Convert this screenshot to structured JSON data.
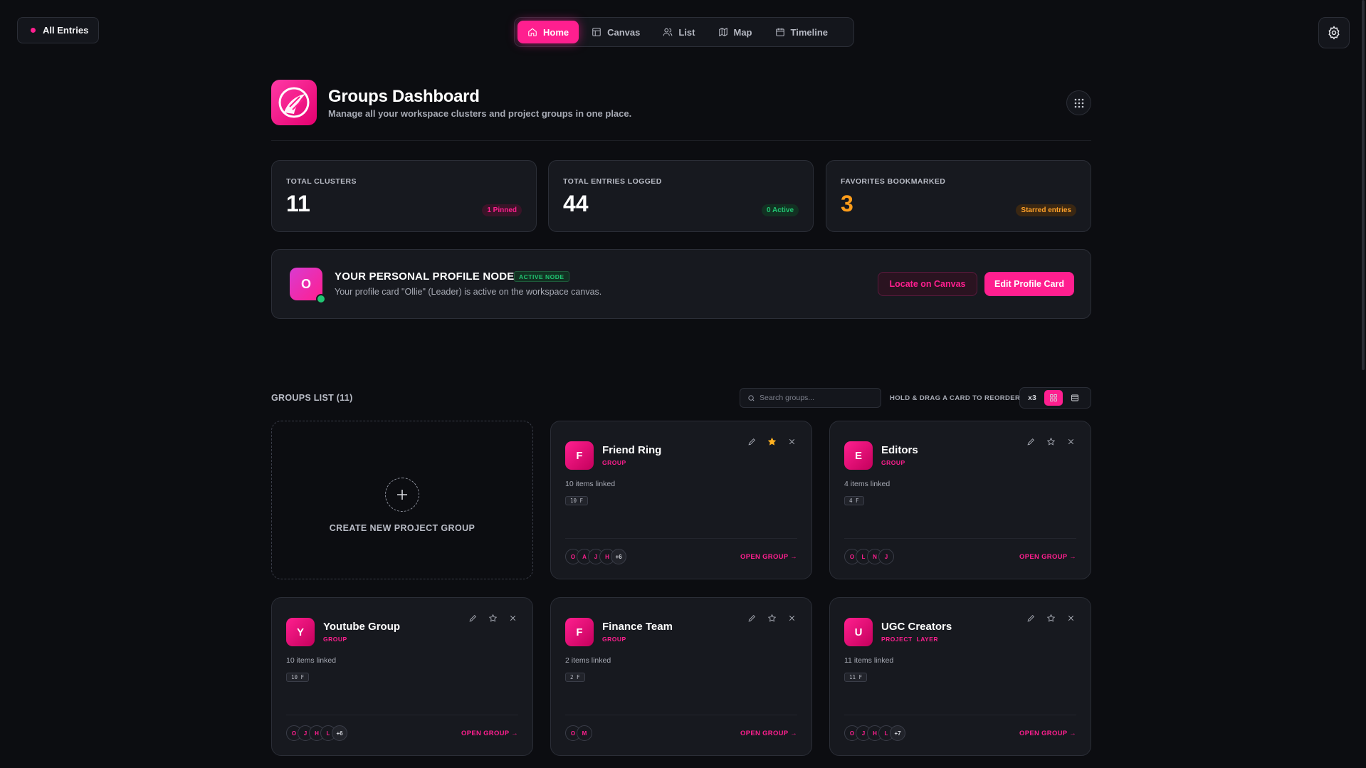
{
  "top": {
    "all_entries": "All Entries",
    "nav": [
      "Home",
      "Canvas",
      "List",
      "Map",
      "Timeline"
    ]
  },
  "header": {
    "title": "Groups Dashboard",
    "subtitle": "Manage all your workspace clusters and project groups in one place."
  },
  "stats": [
    {
      "label": "TOTAL CLUSTERS",
      "value": "11",
      "badge": "1 Pinned"
    },
    {
      "label": "TOTAL ENTRIES LOGGED",
      "value": "44",
      "badge": "0 Active"
    },
    {
      "label": "FAVORITES BOOKMARKED",
      "value": "3",
      "badge": "Starred entries"
    }
  ],
  "profile": {
    "initial": "O",
    "title": "YOUR PERSONAL PROFILE NODE",
    "badge": "ACTIVE NODE",
    "description": "Your profile card \"Ollie\" (Leader) is active on the workspace canvas.",
    "locate_label": "Locate on Canvas",
    "edit_label": "Edit Profile Card"
  },
  "groups": {
    "title": "GROUPS LIST (11)",
    "search_placeholder": "Search groups...",
    "drag_hint": "HOLD & DRAG A CARD TO REORDER",
    "view_x3": "x3",
    "create_label": "CREATE NEW PROJECT GROUP",
    "open_label": "OPEN GROUP →",
    "cards": [
      {
        "initial": "F",
        "name": "Friend Ring",
        "type": "GROUP",
        "linked": "10 items linked",
        "tag": "10 F",
        "starred": true,
        "avatars": [
          "O",
          "A",
          "J",
          "H",
          "+6"
        ]
      },
      {
        "initial": "E",
        "name": "Editors",
        "type": "GROUP",
        "linked": "4 items linked",
        "tag": "4 F",
        "starred": false,
        "avatars": [
          "O",
          "L",
          "N",
          "J"
        ]
      },
      {
        "initial": "Y",
        "name": "Youtube Group",
        "type": "GROUP",
        "linked": "10 items linked",
        "tag": "10 F",
        "starred": false,
        "avatars": [
          "O",
          "J",
          "H",
          "L",
          "+6"
        ]
      },
      {
        "initial": "F",
        "name": "Finance Team",
        "type": "GROUP",
        "linked": "2 items linked",
        "tag": "2 F",
        "starred": false,
        "avatars": [
          "O",
          "M"
        ]
      },
      {
        "initial": "U",
        "name": "UGC Creators",
        "type": "PROJECT LAYER",
        "linked": "11 items linked",
        "tag": "11 F",
        "starred": false,
        "avatars": [
          "O",
          "J",
          "H",
          "L",
          "+7"
        ]
      }
    ]
  },
  "colors": {
    "accent": "#ff1f8f",
    "success": "#21c572",
    "warning": "#ff9d1a",
    "background": "#0c0d11"
  }
}
